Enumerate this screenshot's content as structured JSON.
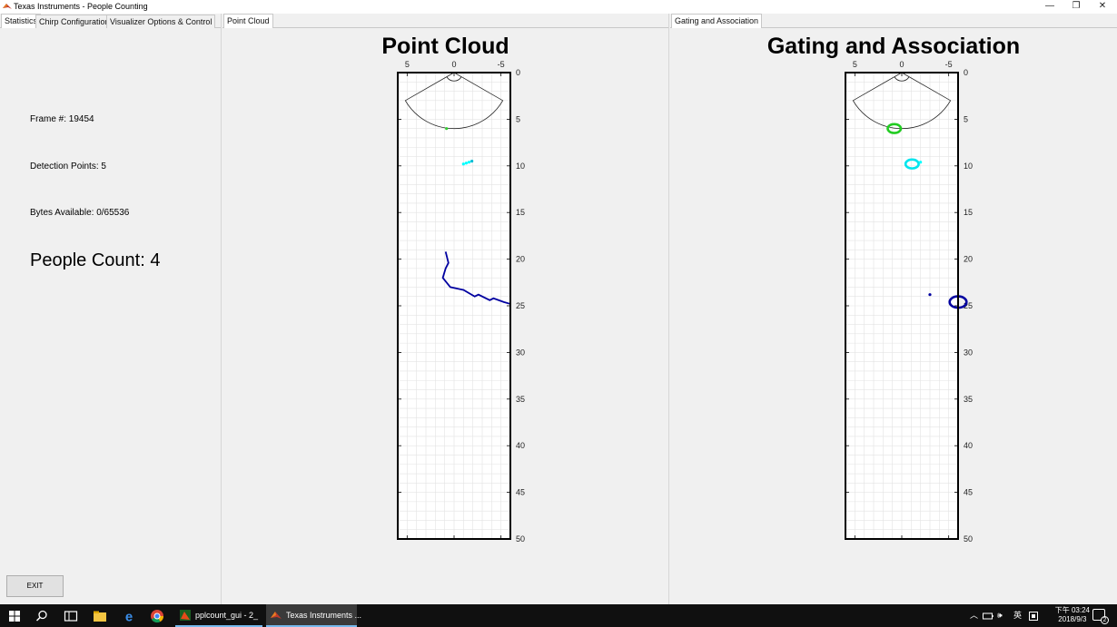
{
  "window": {
    "title": "Texas Instruments - People Counting",
    "minimize_glyph": "—",
    "restore_glyph": "❐",
    "close_glyph": "✕"
  },
  "left_panel": {
    "tabs": [
      "Statistics",
      "Chirp Configuration",
      "Visualizer Options & Control"
    ],
    "active_tab": "Statistics",
    "frame": "Frame #: 19454",
    "detection_points": "Detection Points: 5",
    "bytes_available": "Bytes Available: 0/65536",
    "people_count": "People Count: 4",
    "exit_label": "EXIT"
  },
  "point_cloud_panel": {
    "tab": "Point Cloud",
    "title": "Point Cloud"
  },
  "gating_panel": {
    "tab": "Gating and Association",
    "title": "Gating and Association"
  },
  "chart_data": [
    {
      "type": "scatter",
      "title": "Point Cloud",
      "x_ticks": [
        "5",
        "0",
        "-5"
      ],
      "y_ticks": [
        "0",
        "5",
        "10",
        "15",
        "20",
        "25",
        "30",
        "35",
        "40",
        "45",
        "50"
      ],
      "xlim": [
        6,
        -6
      ],
      "ylim": [
        0,
        50
      ],
      "x_reversed": true,
      "y_reversed": true,
      "grid": true,
      "sensor_fov": {
        "range_m": 6,
        "half_angle_deg": 60
      },
      "points": [
        {
          "x": 0.8,
          "y": 6.0,
          "color": "#32cd32"
        },
        {
          "x": -1.0,
          "y": 9.8,
          "color": "#00ffff"
        },
        {
          "x": -1.3,
          "y": 9.7,
          "color": "#00ffff"
        },
        {
          "x": -1.6,
          "y": 9.6,
          "color": "#00ffff"
        },
        {
          "x": -1.9,
          "y": 9.5,
          "color": "#00bcd4"
        }
      ],
      "tracks": [
        {
          "color": "#0000a0",
          "x": [
            0.9,
            0.6,
            0.9,
            1.2,
            0.8,
            0.4,
            -1.0,
            -2.2,
            -2.6,
            -3.8,
            -4.2,
            -5.3,
            -6.0
          ],
          "y": [
            19.2,
            20.4,
            21.0,
            22.0,
            22.5,
            23.0,
            23.3,
            24.0,
            23.8,
            24.4,
            24.2,
            24.6,
            24.8
          ]
        }
      ]
    },
    {
      "type": "scatter",
      "title": "Gating and Association",
      "x_ticks": [
        "5",
        "0",
        "-5"
      ],
      "y_ticks": [
        "0",
        "5",
        "10",
        "15",
        "20",
        "25",
        "30",
        "35",
        "40",
        "45",
        "50"
      ],
      "xlim": [
        6,
        -6
      ],
      "ylim": [
        0,
        50
      ],
      "x_reversed": true,
      "y_reversed": true,
      "grid": true,
      "sensor_fov": {
        "range_m": 6,
        "half_angle_deg": 60
      },
      "points": [
        {
          "x": -2.0,
          "y": 9.6,
          "color": "#00ffff"
        },
        {
          "x": -3.0,
          "y": 23.8,
          "color": "#0000a0"
        }
      ],
      "gates": [
        {
          "x": 0.8,
          "y": 6.0,
          "r": 0.7,
          "color": "#22cc22"
        },
        {
          "x": -1.1,
          "y": 9.8,
          "r": 0.7,
          "color": "#00e5ee"
        },
        {
          "x": -6.0,
          "y": 24.6,
          "r": 0.9,
          "color": "#0000a0"
        }
      ]
    }
  ],
  "taskbar": {
    "apps": [
      {
        "label": "pplcount_gui - 2_",
        "active": false
      },
      {
        "label": "Texas Instruments ...",
        "active": true
      }
    ],
    "tray_lang": "英",
    "clock_time": "下午 03:24",
    "clock_date": "2018/9/3",
    "notification_count": "2"
  }
}
